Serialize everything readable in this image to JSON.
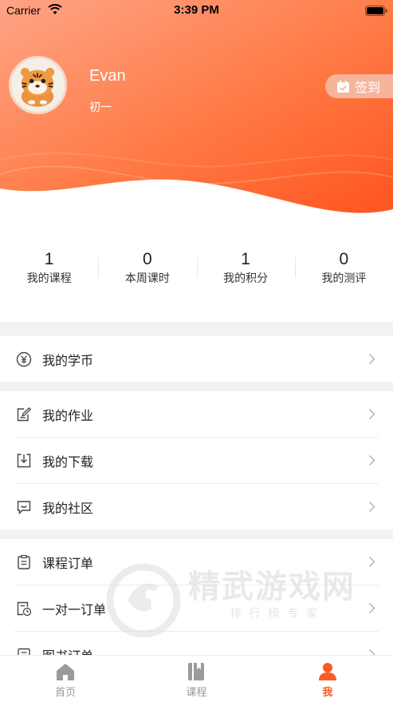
{
  "status_bar": {
    "carrier": "Carrier",
    "time": "3:39 PM"
  },
  "profile": {
    "name": "Evan",
    "grade": "初一",
    "checkin_label": "签到"
  },
  "stats": [
    {
      "value": "1",
      "label": "我的课程"
    },
    {
      "value": "0",
      "label": "本周课时"
    },
    {
      "value": "1",
      "label": "我的积分"
    },
    {
      "value": "0",
      "label": "我的测评"
    }
  ],
  "menu": {
    "coins": "我的学币",
    "homework": "我的作业",
    "downloads": "我的下载",
    "community": "我的社区",
    "course_orders": "课程订单",
    "one_on_one_orders": "一对一订单",
    "book_orders": "图书订单"
  },
  "watermark": {
    "title": "精武游戏网",
    "subtitle": "排行榜专家"
  },
  "tabbar": [
    {
      "label": "首页",
      "icon": "home-icon"
    },
    {
      "label": "课程",
      "icon": "book-icon"
    },
    {
      "label": "我",
      "icon": "person-icon"
    }
  ],
  "colors": {
    "accent": "#fb5a22",
    "header_start": "#fda083",
    "header_end": "#ff5520"
  }
}
